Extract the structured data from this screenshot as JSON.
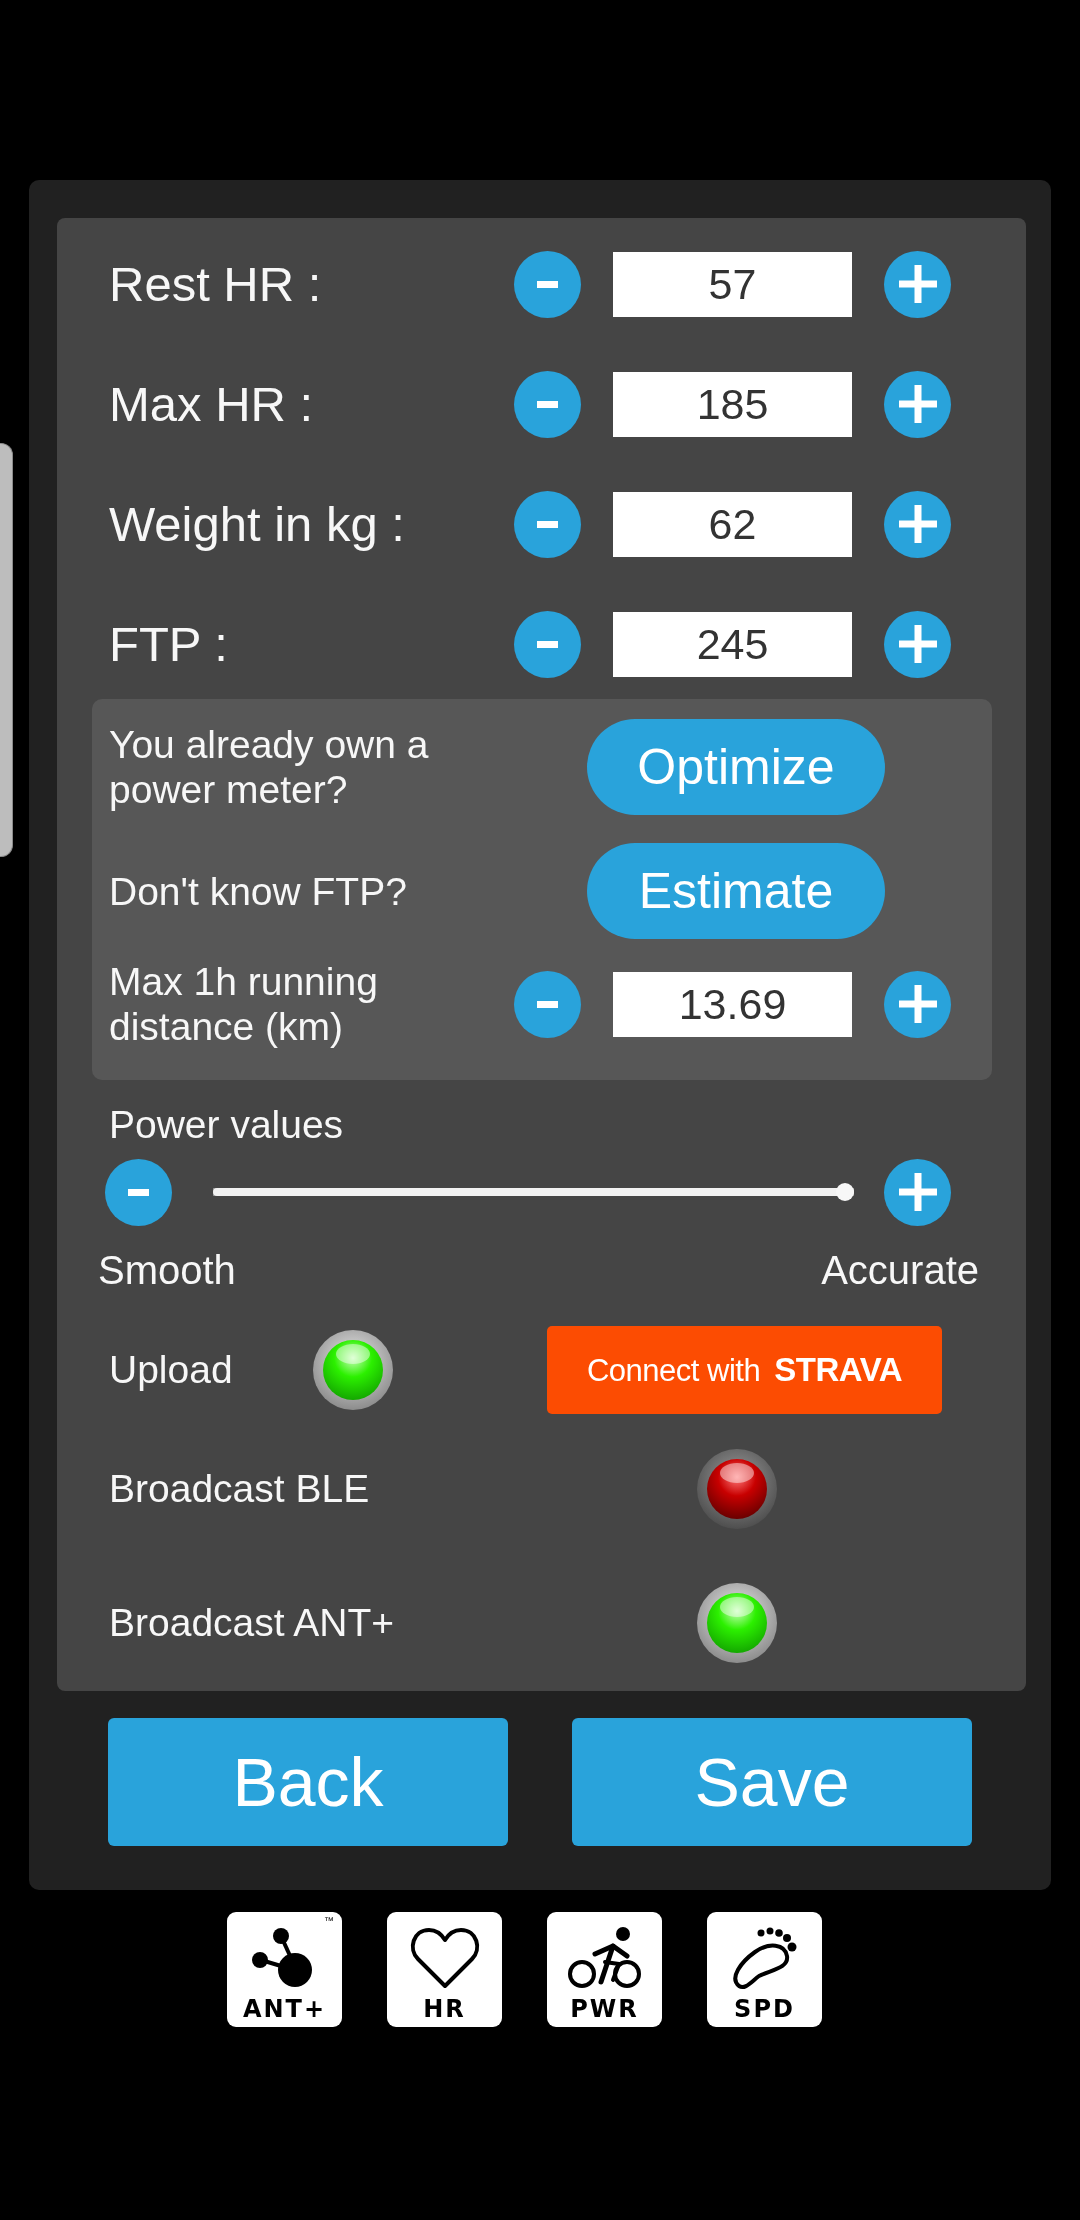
{
  "fields": [
    {
      "label": "Rest HR :",
      "value": "57"
    },
    {
      "label": "Max HR :",
      "value": "185"
    },
    {
      "label": "Weight in kg :",
      "value": "62"
    },
    {
      "label": "FTP :",
      "value": "245"
    }
  ],
  "ftp_help": [
    {
      "kind": "action",
      "label": "You already own a power meter?",
      "button": "Optimize"
    },
    {
      "kind": "action",
      "label": "Don't know FTP?",
      "button": "Estimate"
    },
    {
      "kind": "stepper",
      "label": "Max 1h running distance (km)",
      "value": "13.69"
    }
  ],
  "power_values": {
    "label": "Power values",
    "level": 1,
    "min_label": "Smooth",
    "max_label": "Accurate"
  },
  "toggles": [
    {
      "label": "Upload",
      "on": true,
      "button": "Connect with **STRAVA**"
    },
    {
      "label": "Broadcast BLE",
      "on": false
    },
    {
      "label": "Broadcast ANT+",
      "on": true
    }
  ],
  "buttons": [
    "Back",
    "Save"
  ],
  "sensors": [
    {
      "kind": "ant",
      "label": "ANT+",
      "trademark": "™"
    },
    {
      "kind": "hr",
      "label": "HR"
    },
    {
      "kind": "power",
      "label": "PWR"
    },
    {
      "kind": "speed",
      "label": "SPD"
    }
  ]
}
